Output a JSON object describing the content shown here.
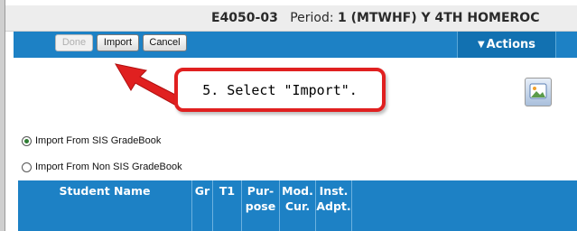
{
  "header": {
    "section": "E4050-03",
    "period_label": "Period:",
    "period_value": "1 (MTWHF) Y 4TH HOMEROC"
  },
  "toolbar": {
    "done_label": "Done",
    "import_label": "Import",
    "cancel_label": "Cancel",
    "actions_label": "Actions",
    "colors": {
      "bar": "#1d81c5",
      "tab": "#1271b1"
    }
  },
  "callout": {
    "text": "5. Select \"Import\".",
    "border_color": "#e02020"
  },
  "import_options": [
    {
      "label": "Import From SIS GradeBook",
      "selected": true
    },
    {
      "label": "Import From Non SIS GradeBook",
      "selected": false
    }
  ],
  "grid": {
    "columns": [
      {
        "label": "Student Name"
      },
      {
        "label": "Gr"
      },
      {
        "label": "T1"
      },
      {
        "label": "Pur- pose"
      },
      {
        "label": "Mod. Cur."
      },
      {
        "label": "Inst. Adpt."
      }
    ]
  },
  "icons": [
    "caret-down-icon",
    "photo-icon",
    "radio-icon"
  ]
}
